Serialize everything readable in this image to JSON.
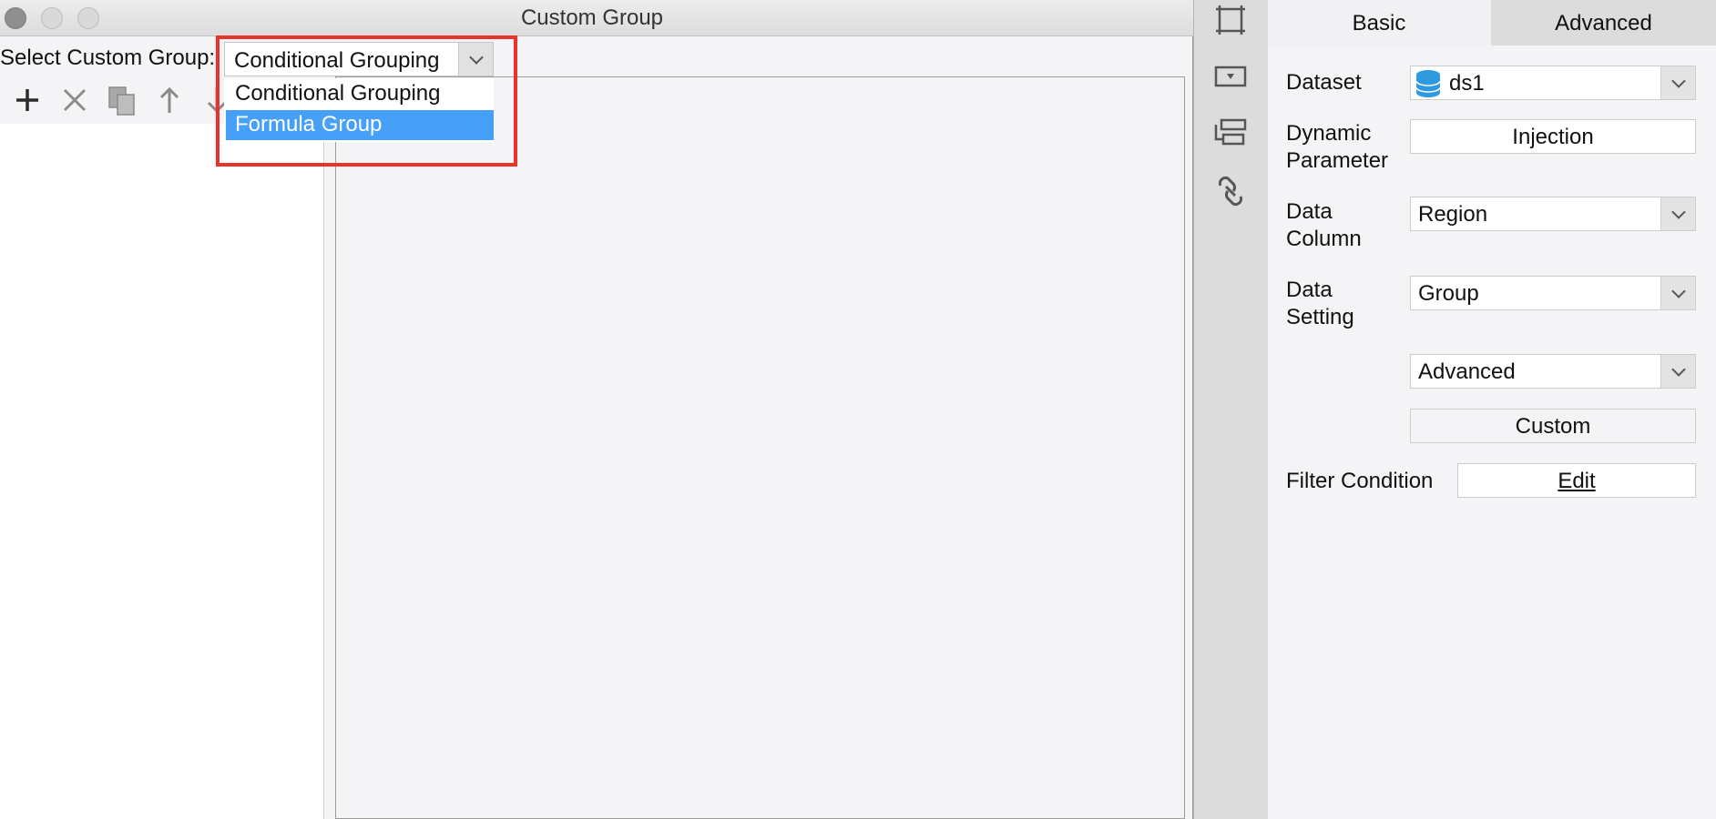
{
  "dialog": {
    "title": "Custom Group",
    "select_label": "Select Custom Group:",
    "selected_value": "Conditional Grouping",
    "dropdown_options": [
      "Conditional Grouping",
      "Formula Group"
    ],
    "highlighted_option": "Formula Group",
    "highlight_color": "#e8322a",
    "selection_color": "#47a0f8",
    "toolbar_icons": [
      "add-icon",
      "remove-icon",
      "copy-icon",
      "move-up-icon",
      "move-down-icon"
    ]
  },
  "side_strip": {
    "icons": [
      "frame-icon",
      "dropdown-box-icon",
      "list-layout-icon",
      "link-icon"
    ]
  },
  "props": {
    "tabs": [
      "Basic",
      "Advanced"
    ],
    "dataset_label": "Dataset",
    "dataset_value": "ds1",
    "dynamic_parameter_label": "Dynamic Parameter",
    "injection_button": "Injection",
    "data_column_label": "Data Column",
    "data_column_value": "Region",
    "data_setting_label": "Data Setting",
    "data_setting_value": "Group",
    "advanced_value": "Advanced",
    "custom_button": "Custom",
    "filter_condition_label": "Filter Condition",
    "edit_button": "Edit"
  }
}
